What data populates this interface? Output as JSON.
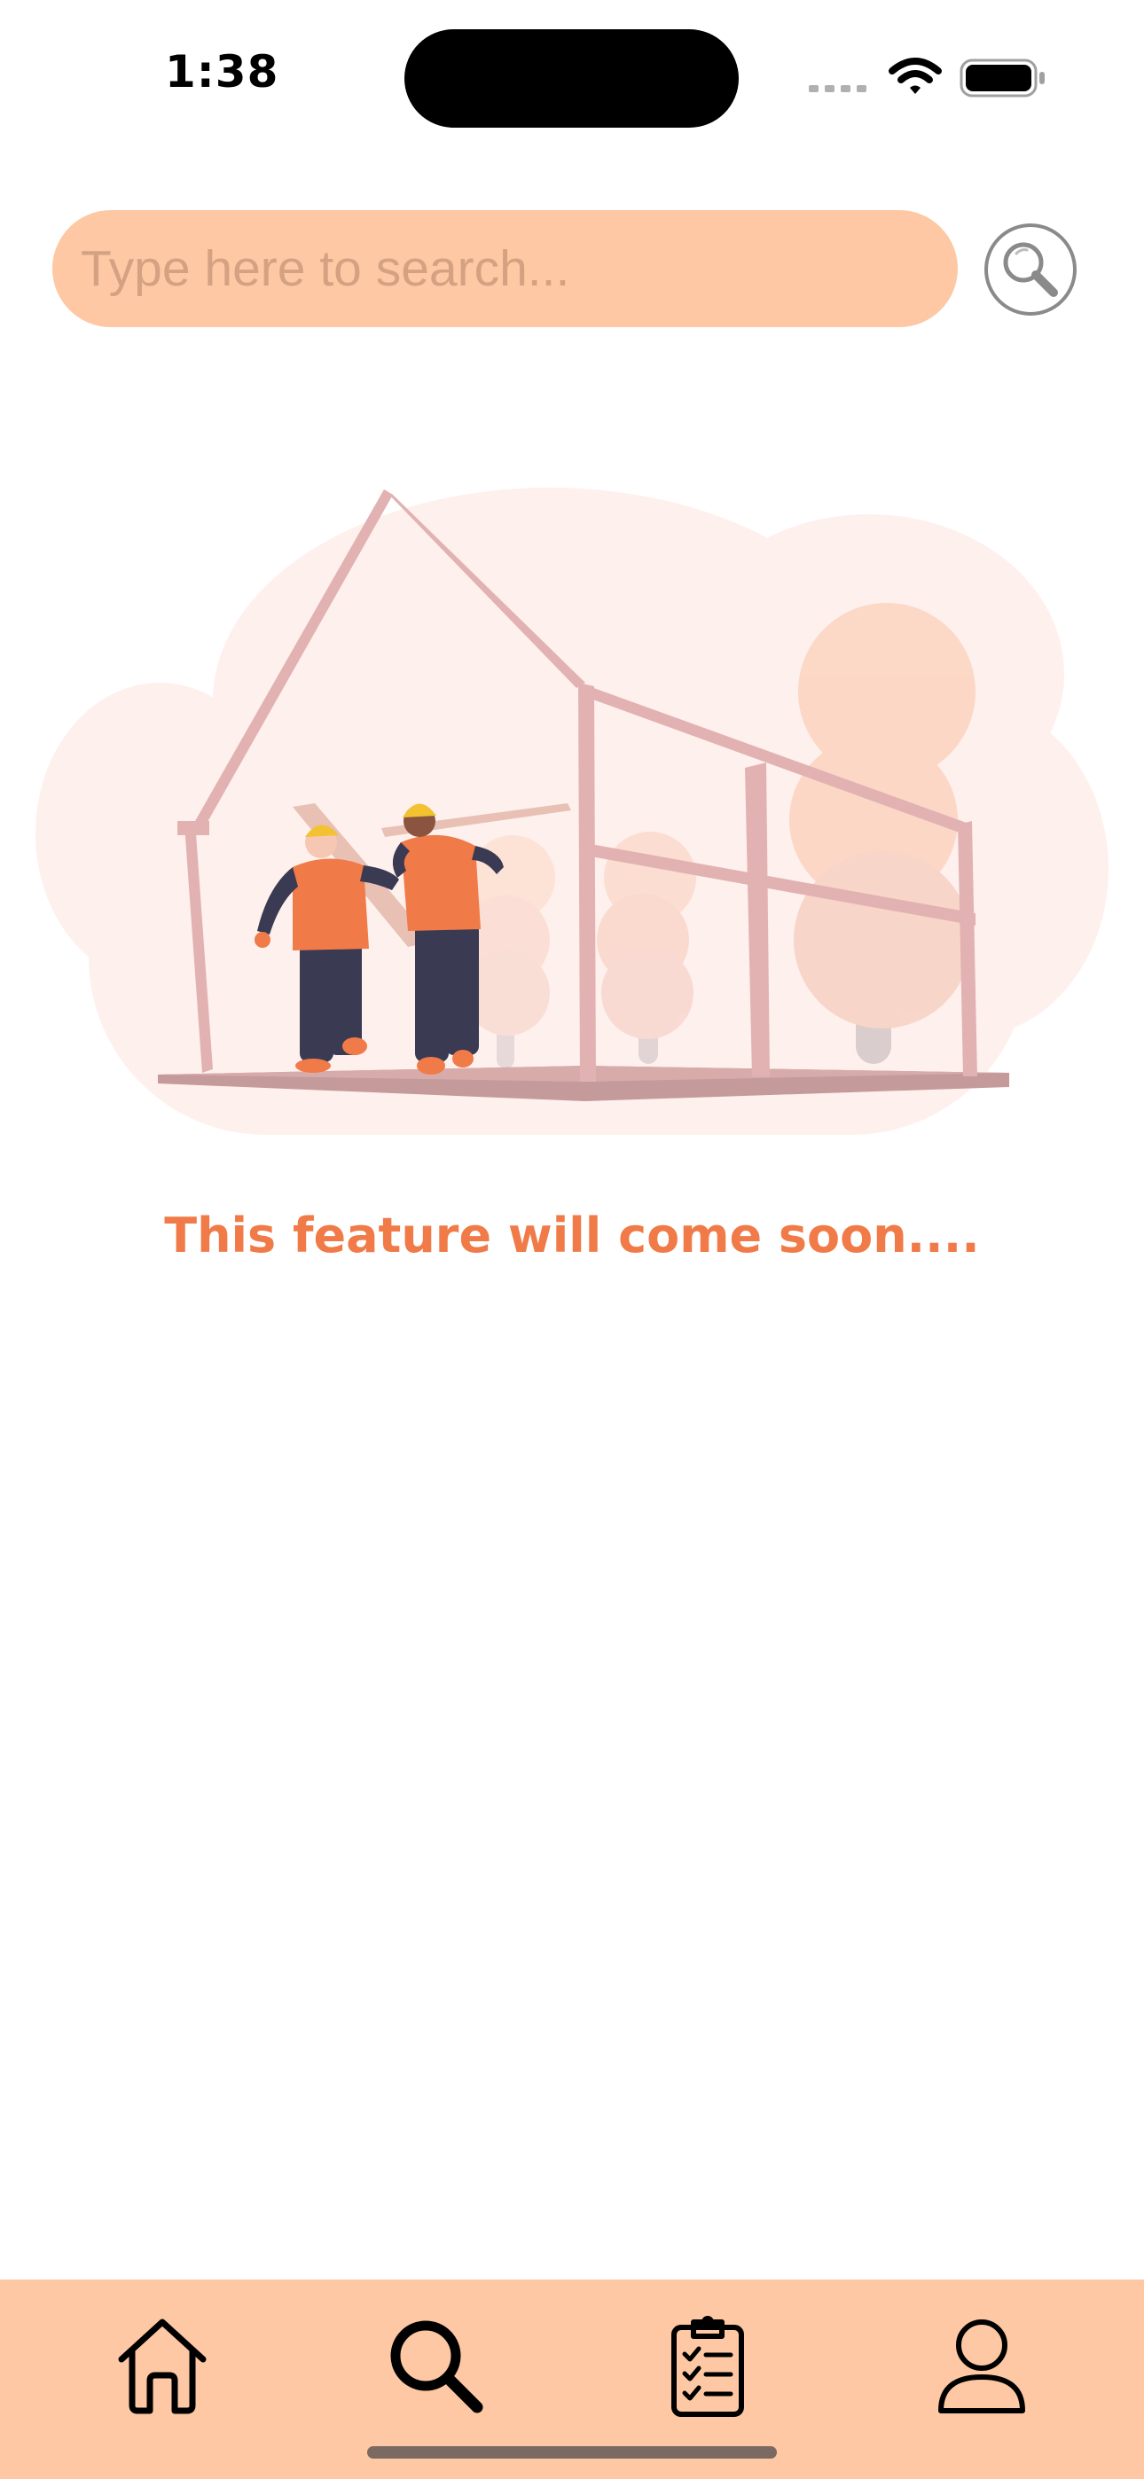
{
  "status_bar": {
    "time": "1:38"
  },
  "search": {
    "placeholder": "Type here to search...",
    "value": "",
    "button_icon": "magnifier-icon"
  },
  "illustration": {
    "subject": "construction-workers-house-frame-illustration"
  },
  "main": {
    "message": "This feature will come soon...."
  },
  "tab_bar": {
    "items": [
      {
        "icon": "home-icon",
        "active": false
      },
      {
        "icon": "search-icon",
        "active": true
      },
      {
        "icon": "clipboard-checklist-icon",
        "active": false
      },
      {
        "icon": "profile-icon",
        "active": false
      }
    ]
  },
  "colors": {
    "accent": "#f07b48",
    "search_background": "#fdc8a3",
    "tab_bar_background": "#fdc8a3",
    "placeholder": "#d5a183"
  }
}
